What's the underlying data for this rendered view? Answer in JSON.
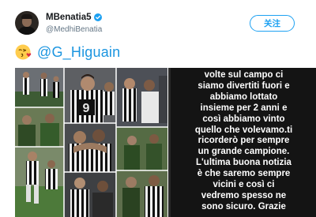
{
  "account": {
    "display_name": "MBenatia5",
    "handle": "@MedhiBenatia",
    "verified": true,
    "follow_label": "关注"
  },
  "tweet": {
    "emoji": "kissing-face-with-heart-emoji",
    "mention": "@G_Higuain"
  },
  "media": {
    "collage_description": "photo-collage",
    "story_lines": [
      "volte sul campo ci",
      "siamo divertiti fuori e",
      "abbiamo lottato",
      "insieme per 2 anni e",
      "così abbiamo vinto",
      "quello che volevamo.ti",
      "ricorderò per sempre",
      "un grande campione.",
      "L'ultima buona notizia",
      "è che saremo sempre",
      "vicini e così ci",
      "vedremo spesso ne",
      "sono sicuro. Grazie"
    ]
  },
  "colors": {
    "accent": "#1da1f2",
    "mention": "#1b95e0",
    "story_bg": "#141414"
  }
}
